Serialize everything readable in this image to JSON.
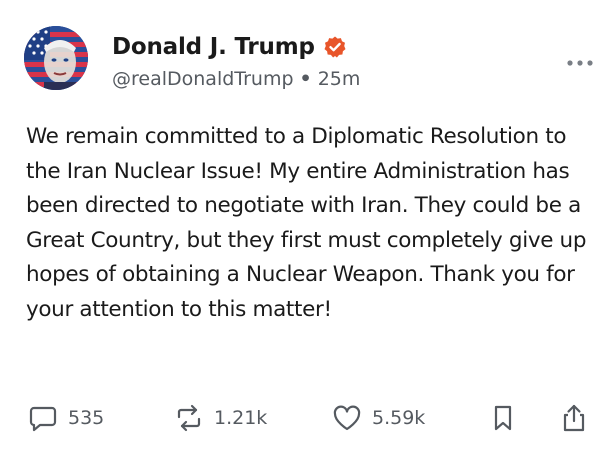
{
  "post": {
    "display_name": "Donald J. Trump",
    "handle": "@realDonaldTrump",
    "separator": "•",
    "time": "25m",
    "body": "We remain committed to a Diplomatic Resolution to the Iran Nuclear Issue! My entire Administration has been directed to negotiate with Iran. They could be a Great Country, but they first must completely give up hopes of obtaining a Nuclear Weapon. Thank you for your attention to this matter!",
    "verified_icon": "verified-badge-icon",
    "verified_color": "#e8552a"
  },
  "actions": {
    "replies": "535",
    "reposts": "1.21k",
    "likes": "5.59k"
  },
  "colors": {
    "text": "#1a1a1a",
    "muted": "#555a60",
    "background": "#ffffff"
  }
}
